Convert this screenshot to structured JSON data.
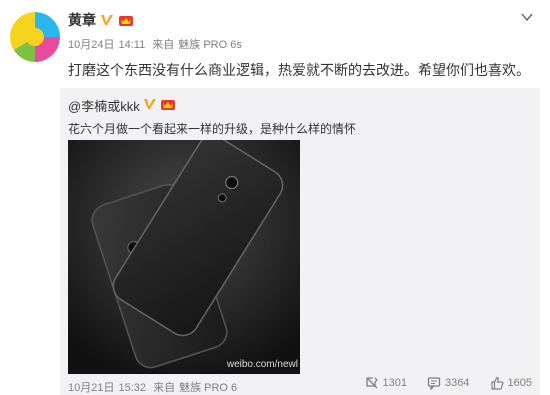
{
  "post": {
    "author": "黄章",
    "date": "10月24日",
    "time": "14:11",
    "source_prefix": "来自",
    "source": "魅族 PRO 6s",
    "text": "打磨这个东西没有什么商业逻辑，热爱就不断的去改进。希望你们也喜欢。"
  },
  "repost": {
    "user": "@李楠或kkk",
    "text": "花六个月做一个看起来一样的升级，是种什么样的情怀",
    "watermark": "weibo.com/newl",
    "date": "10月21日",
    "time": "15:32",
    "source_prefix": "来自",
    "source": "魅族 PRO 6",
    "repost_count": "1301",
    "comment_count": "3364",
    "like_count": "1605"
  },
  "icons": {
    "verified": "verified-v-badge-icon",
    "member": "member-crown-icon",
    "menu": "chevron-down-icon",
    "repost": "repost-icon",
    "comment": "comment-icon",
    "like": "like-icon"
  },
  "colors": {
    "verified": "#f5a623",
    "member": "#e8372c",
    "repost_bg": "#f2f2f5"
  }
}
